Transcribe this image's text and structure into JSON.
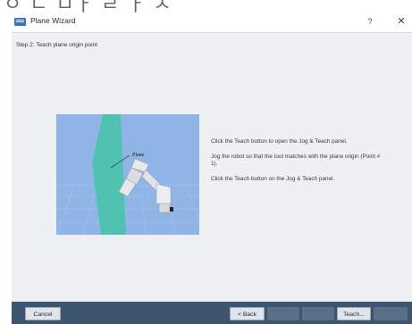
{
  "window": {
    "title": "Plane Wizard",
    "help_glyph": "?",
    "close_glyph": "✕",
    "icon": "wizard-app-icon"
  },
  "step": {
    "title": "Step 2: Teach plane origin point"
  },
  "illustration": {
    "label": "Plane",
    "colors": {
      "background": "#8fb5e6",
      "plane": "#4fc2b2",
      "grid": "#a8c6ef",
      "robot": "#e8e8ec"
    }
  },
  "instructions": [
    "Click the Teach button to open the Jog & Teach panel.",
    "Jog the robot so that the tool matches with the plane origin (Point # 1).",
    "Click the Teach button on the Jog & Teach panel."
  ],
  "buttons": {
    "cancel": "Cancel",
    "back": "< Back",
    "next": "",
    "finish": "",
    "teach": "Teach...",
    "extra": ""
  },
  "colors": {
    "content_bg": "#eef1f4",
    "footer_bg": "#3e5570"
  }
}
